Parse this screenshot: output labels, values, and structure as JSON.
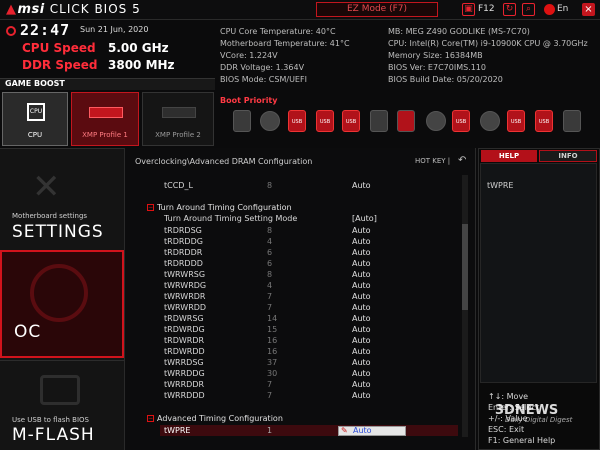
{
  "top": {
    "logo_brand": "msi",
    "logo_text": "CLICK BIOS 5",
    "ez_mode": "EZ Mode (F7)",
    "f12": "F12",
    "lang": "En"
  },
  "status": {
    "time": "22:47",
    "date": "Sun  21 Jun, 2020",
    "cpu_speed_label": "CPU Speed",
    "cpu_speed_value": "5.00 GHz",
    "ddr_speed_label": "DDR Speed",
    "ddr_speed_value": "3800 MHz"
  },
  "sysinfo_left": [
    "CPU Core Temperature: 40°C",
    "Motherboard Temperature: 41°C",
    "VCore: 1.224V",
    "DDR Voltage: 1.364V",
    "BIOS Mode: CSM/UEFI"
  ],
  "sysinfo_right": [
    "MB: MEG Z490 GODLIKE (MS-7C70)",
    "CPU: Intel(R) Core(TM) i9-10900K CPU @ 3.70GHz",
    "Memory Size: 16384MB",
    "BIOS Ver: E7C70IMS.110",
    "BIOS Build Date: 05/20/2020"
  ],
  "game_boost": "GAME BOOST",
  "profiles": [
    "CPU",
    "XMP Profile 1",
    "XMP Profile 2"
  ],
  "boot_priority": "Boot Priority",
  "boot_devices": [
    "hdd",
    "disc",
    "usb",
    "usb",
    "usb",
    "card",
    "hdd",
    "disc",
    "disc",
    "usb",
    "disc",
    "usb",
    "card",
    "card"
  ],
  "nav": {
    "settings_small": "Motherboard settings",
    "settings_big": "SETTINGS",
    "oc_big": "OC",
    "mflash_small": "Use USB to flash BIOS",
    "mflash_big": "M-FLASH"
  },
  "breadcrumb": "Overclocking\\Advanced DRAM Configuration",
  "hotkey": "HOT KEY  |",
  "rows_top": [
    {
      "name": "tCCD_L",
      "value": "8",
      "option": "Auto"
    }
  ],
  "section1": "Turn Around Timing Configuration",
  "section1_setting": {
    "name": "Turn Around Timing Setting Mode",
    "option": "[Auto]"
  },
  "rows_mid": [
    {
      "name": "tRDRDSG",
      "value": "8",
      "option": "Auto"
    },
    {
      "name": "tRDRDDG",
      "value": "4",
      "option": "Auto"
    },
    {
      "name": "tRDRDDR",
      "value": "6",
      "option": "Auto"
    },
    {
      "name": "tRDRDDD",
      "value": "6",
      "option": "Auto"
    },
    {
      "name": "tWRWRSG",
      "value": "8",
      "option": "Auto"
    },
    {
      "name": "tWRWRDG",
      "value": "4",
      "option": "Auto"
    },
    {
      "name": "tWRWRDR",
      "value": "7",
      "option": "Auto"
    },
    {
      "name": "tWRWRDD",
      "value": "7",
      "option": "Auto"
    },
    {
      "name": "tRDWRSG",
      "value": "14",
      "option": "Auto"
    },
    {
      "name": "tRDWRDG",
      "value": "15",
      "option": "Auto"
    },
    {
      "name": "tRDWRDR",
      "value": "16",
      "option": "Auto"
    },
    {
      "name": "tRDWRDD",
      "value": "16",
      "option": "Auto"
    },
    {
      "name": "tWRRDSG",
      "value": "37",
      "option": "Auto"
    },
    {
      "name": "tWRRDDG",
      "value": "30",
      "option": "Auto"
    },
    {
      "name": "tWRRDDR",
      "value": "7",
      "option": "Auto"
    },
    {
      "name": "tWRRDDD",
      "value": "7",
      "option": "Auto"
    }
  ],
  "section2": "Advanced Timing Configuration",
  "selected_row": {
    "name": "tWPRE",
    "value": "1",
    "option": "Auto"
  },
  "help": {
    "help_tab": "HELP",
    "info_tab": "INFO",
    "text": "tWPRE",
    "keys": [
      "↑↓: Move",
      "Enter: Select",
      "+/-: Value",
      "ESC: Exit",
      "F1: General Help"
    ]
  },
  "watermark": {
    "line1": "3DNEWS",
    "line2": "Daily Digital Digest"
  },
  "colors": {
    "accent": "#e8222e",
    "selected_row": "#3d0a0e",
    "background": "#0b0b0c"
  }
}
